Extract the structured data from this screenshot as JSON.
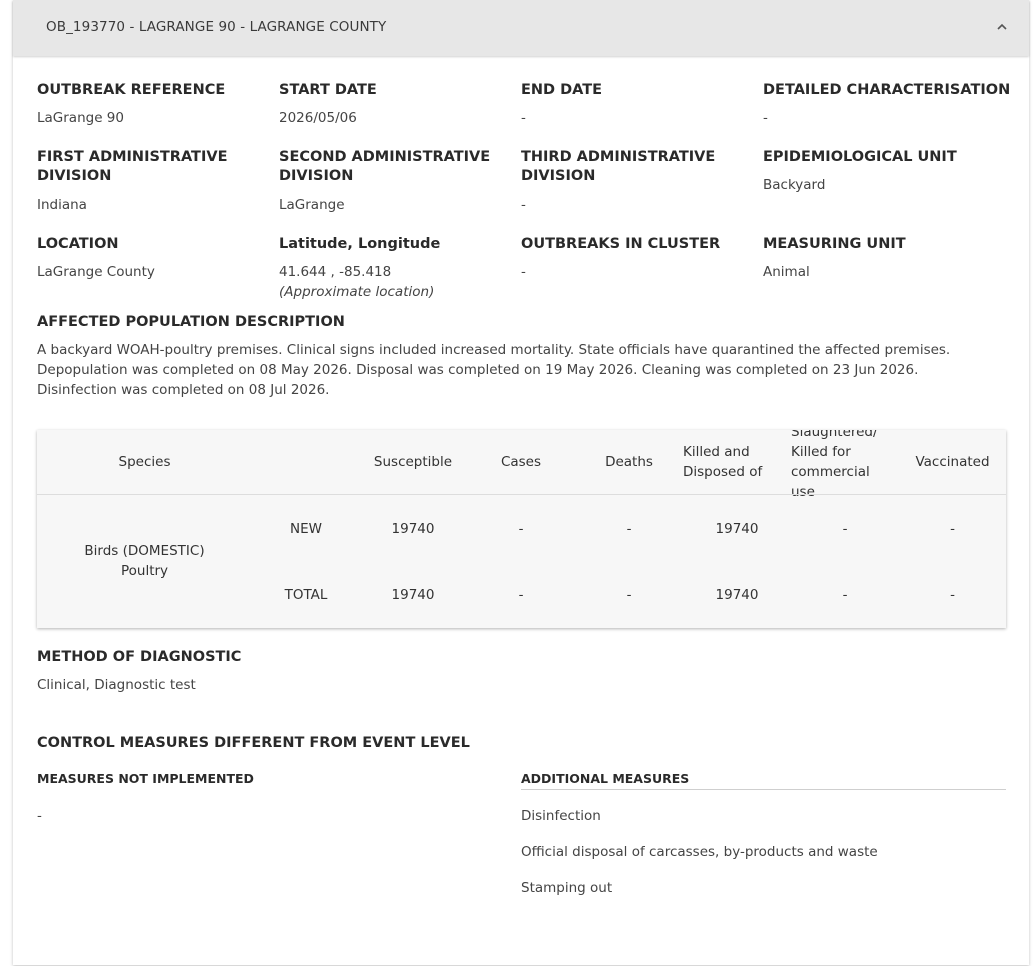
{
  "panel_title": "OB_193770 - LAGRANGE 90 - LAGRANGE COUNTY",
  "fields": {
    "outbreak_reference": {
      "label": "OUTBREAK REFERENCE",
      "value": "LaGrange 90"
    },
    "start_date": {
      "label": "START DATE",
      "value": "2026/05/06"
    },
    "end_date": {
      "label": "END DATE",
      "value": "-"
    },
    "detailed_characterisation": {
      "label": "DETAILED CHARACTERISATION",
      "value": "-"
    },
    "first_admin": {
      "label_1": "FIRST ADMINISTRATIVE",
      "label_2": "DIVISION",
      "value": "Indiana"
    },
    "second_admin": {
      "label_1": "SECOND ADMINISTRATIVE",
      "label_2": "DIVISION",
      "value": "LaGrange"
    },
    "third_admin": {
      "label_1": "THIRD ADMINISTRATIVE",
      "label_2": "DIVISION",
      "value": "-"
    },
    "epi_unit": {
      "label": "EPIDEMIOLOGICAL UNIT",
      "value": "Backyard"
    },
    "location": {
      "label": "LOCATION",
      "value": "LaGrange County"
    },
    "latlon": {
      "label": "Latitude, Longitude",
      "value": "41.644 , -85.418",
      "note": "(Approximate location)"
    },
    "outbreaks_in_cluster": {
      "label": "OUTBREAKS IN CLUSTER",
      "value": "-"
    },
    "measuring_unit": {
      "label": "MEASURING UNIT",
      "value": "Animal"
    }
  },
  "affected_population": {
    "label": "AFFECTED POPULATION DESCRIPTION",
    "text": "A backyard WOAH-poultry premises. Clinical signs included increased mortality. State officials have quarantined the affected premises. Depopulation was completed on 08 May 2026. Disposal was completed on 19 May 2026. Cleaning was completed on 23 Jun 2026. Disinfection was completed on 08 Jul 2026."
  },
  "table": {
    "headers": {
      "species": "Species",
      "susceptible": "Susceptible",
      "cases": "Cases",
      "deaths": "Deaths",
      "killed_1": "Killed and",
      "killed_2": "Disposed of",
      "slaughtered_1": "Slaughtered/",
      "slaughtered_2": "Killed for",
      "slaughtered_3": "commercial",
      "slaughtered_4": "use",
      "vaccinated": "Vaccinated"
    },
    "species_1": "Birds (DOMESTIC)",
    "species_2": "Poultry",
    "rows": [
      {
        "type": "NEW",
        "susceptible": "19740",
        "cases": "-",
        "deaths": "-",
        "killed": "19740",
        "slaughtered": "-",
        "vaccinated": "-"
      },
      {
        "type": "TOTAL",
        "susceptible": "19740",
        "cases": "-",
        "deaths": "-",
        "killed": "19740",
        "slaughtered": "-",
        "vaccinated": "-"
      }
    ]
  },
  "method_of_diagnostic": {
    "label": "METHOD OF DIAGNOSTIC",
    "value": "Clinical, Diagnostic test"
  },
  "control_measures": {
    "label": "CONTROL MEASURES DIFFERENT FROM EVENT LEVEL",
    "not_implemented_label": "MEASURES NOT IMPLEMENTED",
    "not_implemented": [
      "-"
    ],
    "additional_label": "ADDITIONAL MEASURES",
    "additional": [
      "Disinfection",
      "Official disposal of carcasses, by-products and waste",
      "Stamping out"
    ]
  }
}
